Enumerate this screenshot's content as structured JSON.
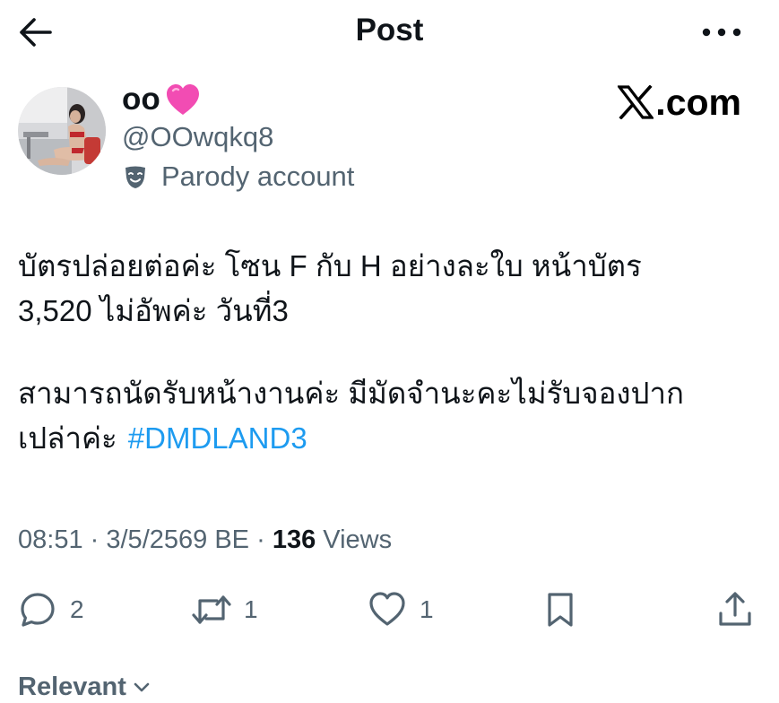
{
  "header": {
    "title": "Post",
    "back_icon": "arrow-left-icon",
    "more_icon": "more-horizontal-icon"
  },
  "author": {
    "display_name": "oo",
    "emoji": "pink-heart-icon",
    "handle": "@OOwqkq8",
    "badge_text": "Parody account",
    "badge_icon": "theater-mask-icon"
  },
  "brand": {
    "text": ".com",
    "logo_icon": "x-logo-icon"
  },
  "tweet": {
    "line1": "บัตรปล่อยต่อค่ะ โซน F กับ H อย่างละใบ หน้าบัตร",
    "line2": "3,520 ไม่อัพค่ะ วันที่3",
    "line3": "สามารถนัดรับหน้างานค่ะ มีมัดจำนะคะไม่รับจองปาก",
    "line4": "เปล่าค่ะ",
    "hashtag": "#DMDLAND3"
  },
  "meta": {
    "time": "08:51",
    "date": "3/5/2569 BE",
    "separator": "·",
    "views_count": "136",
    "views_label": "Views"
  },
  "actions": {
    "replies": "2",
    "reposts": "1",
    "likes": "1"
  },
  "replies_sort": {
    "label": "Relevant"
  },
  "colors": {
    "accent": "#1d9bf0",
    "muted": "#536471",
    "text": "#0f1419",
    "heart": "#f24cb3"
  }
}
